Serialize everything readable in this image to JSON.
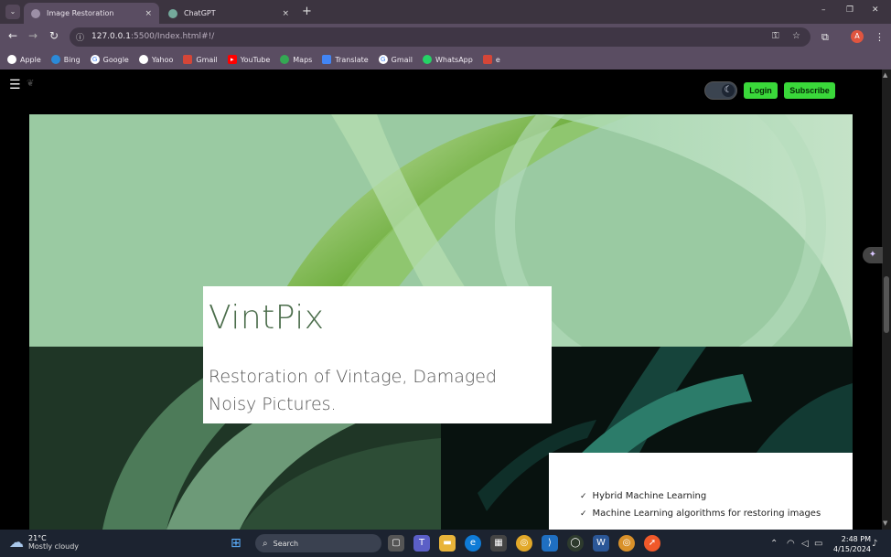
{
  "browser": {
    "tabs": [
      {
        "title": "Image Restoration",
        "close": "×",
        "active": true
      },
      {
        "title": "ChatGPT",
        "close": "×",
        "active": false
      }
    ],
    "new_tab": "+",
    "window_controls": {
      "minimize": "–",
      "restore": "❐",
      "close": "✕"
    },
    "url_host": "127.0.0.1",
    "url_path": ":5500/Index.html#!/",
    "profile_initial": "A",
    "bookmarks": [
      "Apple",
      "Bing",
      "Google",
      "Yahoo",
      "Gmail",
      "YouTube",
      "Maps",
      "Translate",
      "Gmail",
      "WhatsApp",
      "e"
    ]
  },
  "page": {
    "menu_icon": "☰",
    "login_label": "Login",
    "subscribe_label": "Subscribe",
    "theme_toggle_glyph": "☾",
    "hero": {
      "title": "VintPix",
      "tagline": "Restoration of Vintage, Damaged Noisy Pictures."
    },
    "features": [
      "Hybrid Machine Learning",
      "Machine Learning algorithms for restoring images"
    ],
    "check_glyph": "✓"
  },
  "taskbar": {
    "temperature": "21°C",
    "weather": "Mostly cloudy",
    "search_label": "Search",
    "time": "2:48 PM",
    "date": "4/15/2024"
  },
  "colors": {
    "accent_green": "#3ad83a",
    "brand_text": "#4b6d4b",
    "chrome_bg": "#5a4d62"
  }
}
